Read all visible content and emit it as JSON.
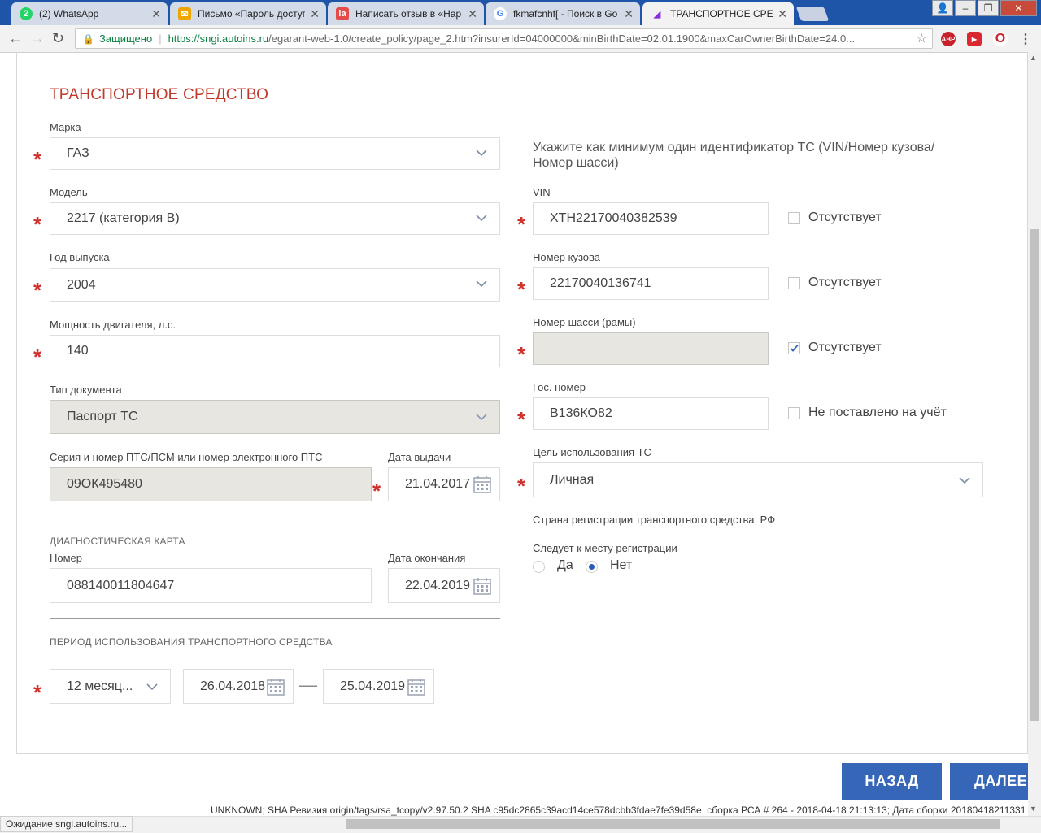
{
  "browser": {
    "tabs": [
      {
        "title": "(2) WhatsApp",
        "favicon": "whatsapp-icon",
        "favicon_text": "2",
        "color": "#25d366"
      },
      {
        "title": "Письмо «Пароль доступ",
        "favicon": "mail-icon",
        "color": "#f0a400"
      },
      {
        "title": "Написать отзыв в «Нар",
        "favicon": "irecommend-icon",
        "favicon_text": "la",
        "color": "#e54b4b"
      },
      {
        "title": "fkmafcnhf[ - Поиск в Go",
        "favicon": "google-icon",
        "favicon_text": "G",
        "color": "#4285f4"
      },
      {
        "title": "ТРАНСПОРТНОЕ СРЕДС",
        "favicon": "page-icon",
        "color": "#8a2be2"
      }
    ],
    "secure_label": "Защищено",
    "url_host": "https://sngi.autoins.ru",
    "url_rest": "/egarant-web-1.0/create_policy/page_2.htm?insurerId=04000000&minBirthDate=02.01.1900&maxCarOwnerBirthDate=24.0...",
    "ext_abp": "ABP"
  },
  "form": {
    "title": "ТРАНСПОРТНОЕ СРЕДСТВО",
    "brand": {
      "label": "Марка",
      "value": "ГАЗ"
    },
    "model": {
      "label": "Модель",
      "value": "2217 (категория В)"
    },
    "year": {
      "label": "Год выпуска",
      "value": "2004"
    },
    "power": {
      "label": "Мощность двигателя, л.с.",
      "value": "140"
    },
    "doc_type": {
      "label": "Тип документа",
      "value": "Паспорт ТС"
    },
    "pts": {
      "label": "Серия и номер ПТС/ПСМ или номер электронного ПТС",
      "value": "09ОК495480"
    },
    "issue_date": {
      "label": "Дата выдачи",
      "value": "21.04.2017"
    },
    "diag": {
      "title": "ДИАГНОСТИЧЕСКАЯ КАРТА",
      "number_label": "Номер",
      "number_value": "088140011804647",
      "end_label": "Дата окончания",
      "end_value": "22.04.2019"
    },
    "period": {
      "title": "ПЕРИОД ИСПОЛЬЗОВАНИЯ ТРАНСПОРТНОГО СРЕДСТВА",
      "duration": "12 месяц...",
      "from": "26.04.2018",
      "dash": "—",
      "to": "25.04.2019"
    },
    "id_hint": "Укажите как минимум один идентификатор ТС (VIN/Номер кузова/ Номер шасси)",
    "vin": {
      "label": "VIN",
      "value": "XTH22170040382539",
      "absent_label": "Отсутствует",
      "absent": false
    },
    "body": {
      "label": "Номер кузова",
      "value": "22170040136741",
      "absent_label": "Отсутствует",
      "absent": false
    },
    "chassis": {
      "label": "Номер шасси (рамы)",
      "value": "",
      "absent_label": "Отсутствует",
      "absent": true
    },
    "plate": {
      "label": "Гос. номер",
      "value": "В136КО82",
      "absent_label": "Не поставлено на учёт",
      "absent": false
    },
    "purpose": {
      "label": "Цель использования ТС",
      "value": "Личная"
    },
    "country": "Страна регистрации транспортного средства: РФ",
    "follows": {
      "label": "Следует к месту регистрации",
      "yes": "Да",
      "no": "Нет",
      "selected": "no"
    },
    "back_button": "НАЗАД",
    "next_button": "ДАЛЕЕ"
  },
  "build_info": "UNKNOWN; SHA Ревизия origin/tags/rsa_tcopy/v2.97.50.2 SHA c95dc2865c39acd14ce578dcbb3fdae7fe39d58e, сборка РСА # 264 - 2018-04-18 21:13:13; Дата сборки 20180418211331",
  "status_text": "Ожидание sngi.autoins.ru...",
  "colors": {
    "accent": "#3566b8",
    "title": "#c0392b",
    "required": "#d0312d",
    "disabled_field": "#e7e6e1"
  }
}
